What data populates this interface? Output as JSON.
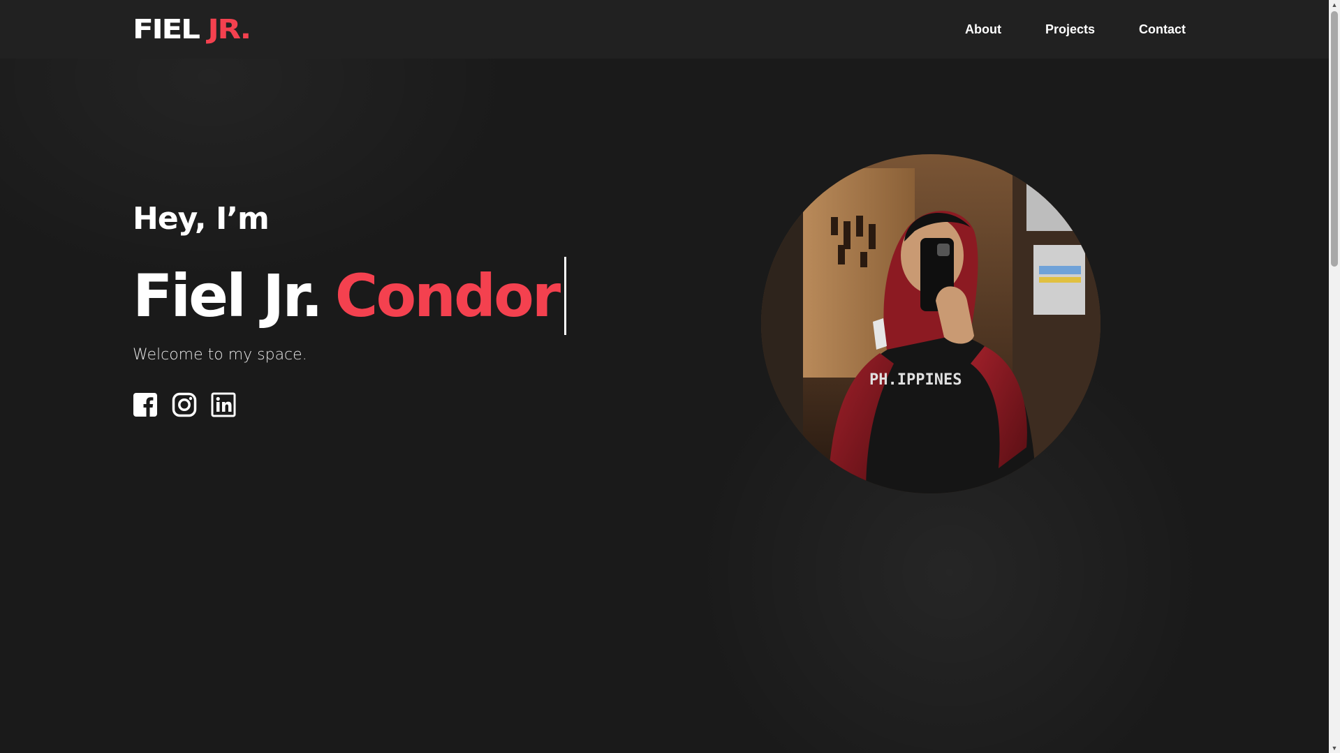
{
  "header": {
    "logo_main": "FIEL",
    "logo_accent": "JR.",
    "nav": [
      {
        "label": "About"
      },
      {
        "label": "Projects"
      },
      {
        "label": "Contact"
      }
    ]
  },
  "hero": {
    "greeting": "Hey, I’m",
    "name_first": "Fiel Jr.",
    "name_last": "Condor",
    "tagline": "Welcome to my space.",
    "socials": [
      {
        "icon": "facebook-icon"
      },
      {
        "icon": "instagram-icon"
      },
      {
        "icon": "linkedin-icon"
      }
    ],
    "portrait_icon": "profile-photo"
  },
  "colors": {
    "background": "#1a1a1a",
    "header_bg": "#212121",
    "accent": "#f4414f",
    "text": "#ffffff"
  }
}
